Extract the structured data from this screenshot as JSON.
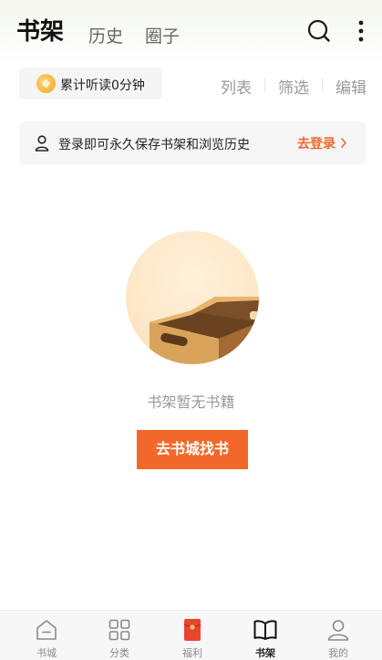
{
  "header": {
    "tabs": [
      {
        "label": "书架",
        "active": true
      },
      {
        "label": "历史",
        "active": false
      },
      {
        "label": "圈子",
        "active": false
      }
    ],
    "icons": [
      "search-icon",
      "more-icon"
    ]
  },
  "listen": {
    "text": "累计听读0分钟",
    "icon": "coin-icon"
  },
  "actions": {
    "list": "列表",
    "filter": "筛选",
    "edit": "编辑"
  },
  "login_banner": {
    "text": "登录即可永久保存书架和浏览历史",
    "link": "去登录",
    "icon": "user-icon"
  },
  "empty_state": {
    "message": "书架暂无书籍",
    "button": "去书城找书",
    "illustration": "empty-box-illustration"
  },
  "bottom_nav": {
    "items": [
      {
        "label": "书城",
        "icon": "home-icon",
        "active": false
      },
      {
        "label": "分类",
        "icon": "grid-icon",
        "active": false
      },
      {
        "label": "福利",
        "icon": "red-envelope-icon",
        "active": false
      },
      {
        "label": "书架",
        "icon": "book-icon",
        "active": true
      },
      {
        "label": "我的",
        "icon": "profile-icon",
        "active": false
      }
    ]
  },
  "colors": {
    "accent": "#f2682b",
    "coin": "#f5b53a",
    "envelope": "#e8452f"
  }
}
